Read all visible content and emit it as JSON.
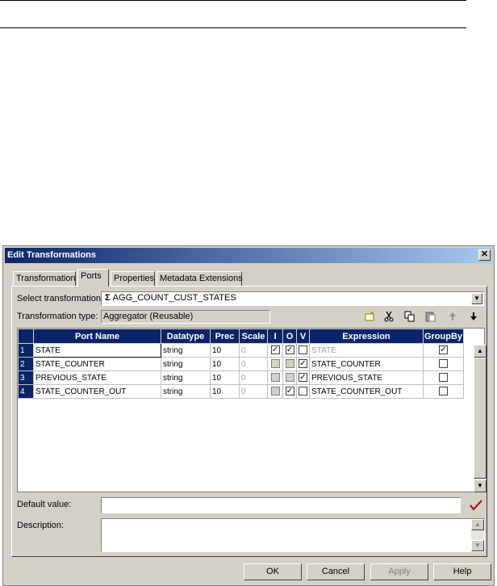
{
  "dialog": {
    "title": "Edit Transformations",
    "close_glyph": "✕"
  },
  "tabs": [
    {
      "label": "Transformation"
    },
    {
      "label": "Ports"
    },
    {
      "label": "Properties"
    },
    {
      "label": "Metadata Extensions"
    }
  ],
  "form": {
    "select_label": "Select transformation:",
    "select_value": "AGG_COUNT_CUST_STATES",
    "type_label": "Transformation type:",
    "type_value": "Aggregator (Reusable)",
    "default_label": "Default value:",
    "default_value": "",
    "description_label": "Description:",
    "description_value": ""
  },
  "toolbar_icons": [
    "new-port-icon",
    "cut-icon",
    "copy-icon",
    "paste-icon",
    "move-up-icon",
    "move-down-icon"
  ],
  "grid": {
    "columns": [
      "Port Name",
      "Datatype",
      "Prec",
      "Scale",
      "I",
      "O",
      "V",
      "Expression",
      "GroupBy"
    ],
    "rows": [
      {
        "num": "1",
        "name": "STATE",
        "datatype": "string",
        "prec": "10",
        "scale": "0",
        "i": true,
        "o": true,
        "v": false,
        "expression": "STATE",
        "groupby": true
      },
      {
        "num": "2",
        "name": "STATE_COUNTER",
        "datatype": "string",
        "prec": "10",
        "scale": "0",
        "i": false,
        "o": false,
        "v": true,
        "expression": "STATE_COUNTER",
        "groupby": false
      },
      {
        "num": "3",
        "name": "PREVIOUS_STATE",
        "datatype": "string",
        "prec": "10",
        "scale": "0",
        "i": false,
        "o": false,
        "v": true,
        "expression": "PREVIOUS_STATE",
        "groupby": false
      },
      {
        "num": "4",
        "name": "STATE_COUNTER_OUT",
        "datatype": "string",
        "prec": "10",
        "scale": "0",
        "i": false,
        "o": true,
        "v": false,
        "expression": "STATE_COUNTER_OUT",
        "groupby": false
      }
    ]
  },
  "buttons": {
    "ok": "OK",
    "cancel": "Cancel",
    "apply": "Apply",
    "help": "Help"
  },
  "colors": {
    "title_bar": "#0a246a",
    "dialog_bg": "#d4d0c8",
    "validate_check": "#b00000"
  }
}
